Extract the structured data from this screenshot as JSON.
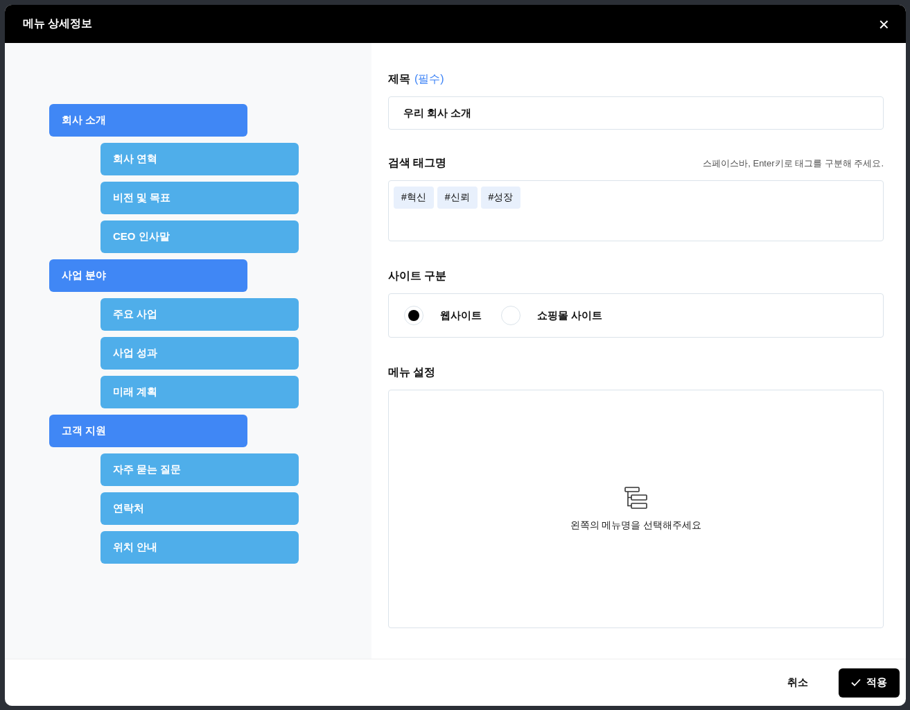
{
  "dialog": {
    "title": "메뉴 상세정보",
    "close_label": "×"
  },
  "menu_tree": [
    {
      "label": "회사 소개",
      "children": [
        {
          "label": "회사 연혁"
        },
        {
          "label": "비전 및 목표"
        },
        {
          "label": "CEO 인사말"
        }
      ]
    },
    {
      "label": "사업 분야",
      "children": [
        {
          "label": "주요 사업"
        },
        {
          "label": "사업 성과"
        },
        {
          "label": "미래 계획"
        }
      ]
    },
    {
      "label": "고객 지원",
      "children": [
        {
          "label": "자주 묻는 질문"
        },
        {
          "label": "연락처"
        },
        {
          "label": "위치 안내"
        }
      ]
    }
  ],
  "title_field": {
    "label": "제목",
    "required_note": "(필수)",
    "value": "우리 회사 소개"
  },
  "tags_field": {
    "label": "검색 태그명",
    "hint": "스페이스바, Enter키로 태그를 구분해 주세요.",
    "tags": [
      "#혁신",
      "#신뢰",
      "#성장"
    ]
  },
  "site_type": {
    "label": "사이트 구분",
    "options": [
      {
        "label": "웹사이트",
        "selected": true
      },
      {
        "label": "쇼핑몰 사이트",
        "selected": false
      }
    ]
  },
  "menu_settings": {
    "label": "메뉴 설정",
    "empty_message": "왼쪽의 메뉴명을 선택해주세요"
  },
  "footer": {
    "cancel": "취소",
    "apply": "적용"
  }
}
